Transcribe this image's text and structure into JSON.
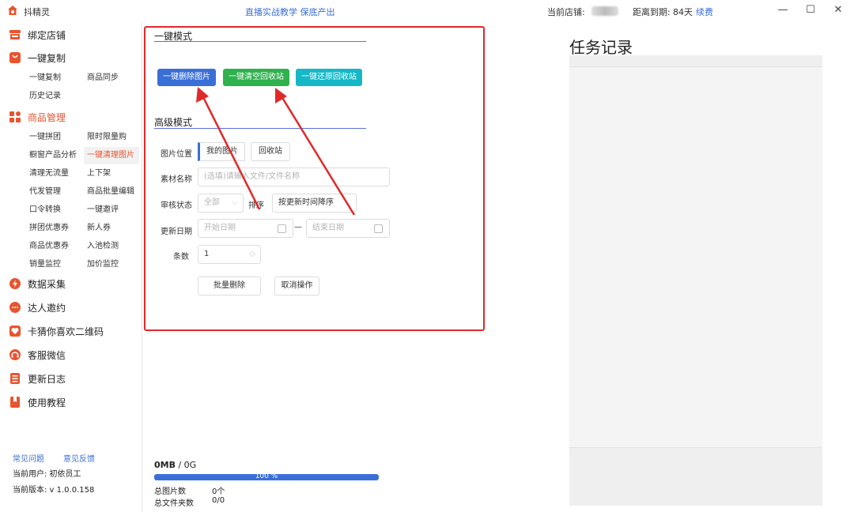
{
  "titlebar": {
    "app_name": "抖精灵",
    "promo": "直播实战教学 保底产出",
    "store_label": "当前店铺:",
    "expire_label": "距离到期:",
    "expire_days": "84天",
    "renew": "续费",
    "minimize": "—",
    "maximize": "☐",
    "close": "✕"
  },
  "sidebar": {
    "bind_store": "绑定店铺",
    "copy_group": "一键复制",
    "copy_items": [
      "一键复制",
      "商品同步",
      "历史记录"
    ],
    "goods_group": "商品管理",
    "goods_items": [
      "一键拼团",
      "限时限量购",
      "橱窗产品分析",
      "一键清理图片",
      "清理无流量",
      "上下架",
      "代发管理",
      "商品批量编辑",
      "口令转换",
      "一键邀评",
      "拼团优惠券",
      "新人券",
      "商品优惠券",
      "入池检测",
      "销量监控",
      "加价监控"
    ],
    "data_collect": "数据采集",
    "influencer": "达人邀约",
    "qr": "卡猜你喜欢二维码",
    "service": "客服微信",
    "changelog": "更新日志",
    "tutorial": "使用教程",
    "faq": "常见问题",
    "feedback": "意见反馈",
    "current_user": "当前用户: 初依员工",
    "version": "当前版本: v 1.0.0.158"
  },
  "main": {
    "quick_mode": "一键模式",
    "btn_delete": "一键删除图片",
    "btn_empty": "一键清空回收站",
    "btn_restore": "一键还原回收站",
    "advanced_mode": "高级模式",
    "img_location_label": "图片位置",
    "seg_my_images": "我的图片",
    "seg_recycle": "回收站",
    "material_label": "素材名称",
    "material_placeholder": "(选填)请输入文件/文件名称",
    "audit_label": "审核状态",
    "audit_value": "全部",
    "sort_label": "排序",
    "sort_value": "按更新时间降序",
    "date_label": "更新日期",
    "start_placeholder": "开始日期",
    "date_sep": "—",
    "end_placeholder": "结束日期",
    "count_label": "条数",
    "count_value": "1",
    "btn_batch_delete": "批量删除",
    "btn_cancel": "取消操作",
    "storage_used": "0MB",
    "storage_total": " / 0G",
    "progress": 100,
    "progress_text": "100 %",
    "total_images_label": "总图片数",
    "total_images_value": "0个",
    "total_folders_label": "总文件夹数",
    "total_folders_value": "0/0"
  },
  "task": {
    "title": "任务记录"
  },
  "colors": {
    "accent": "#3a6fd8",
    "active": "#e8542f",
    "green": "#2fb14e",
    "teal": "#14b8c6",
    "red": "#e02a2a"
  }
}
